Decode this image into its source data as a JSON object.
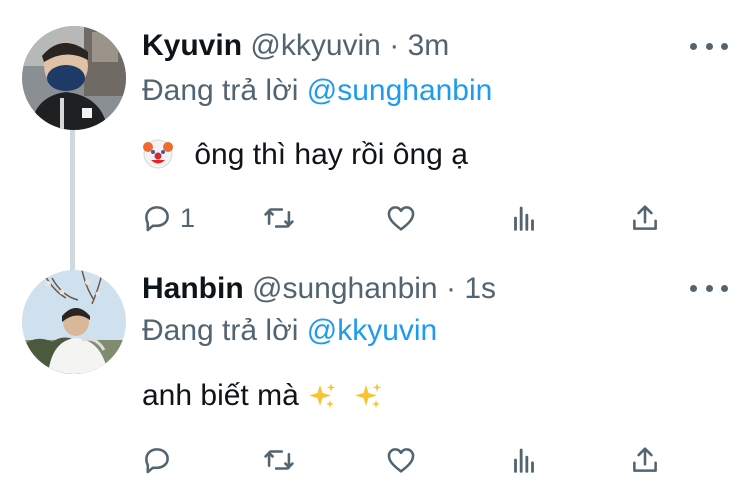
{
  "tweets": [
    {
      "name": "Kyuvin",
      "handle": "@kkyuvin",
      "separator": "·",
      "time": "3m",
      "reply_prefix": "Đang trả lời",
      "reply_to": "@sunghanbin",
      "text": "ông thì hay rồi ông ạ",
      "emoji": "clown-face",
      "reply_count": "1"
    },
    {
      "name": "Hanbin",
      "handle": "@sunghanbin",
      "separator": "·",
      "time": "1s",
      "reply_prefix": "Đang trả lời",
      "reply_to": "@kkyuvin",
      "text": "anh biết mà",
      "emoji": "sparkles",
      "reply_count": ""
    }
  ],
  "icons": [
    "more-icon",
    "reply-icon",
    "retweet-icon",
    "like-icon",
    "stats-icon",
    "share-icon"
  ],
  "colors": {
    "accent": "#1d9bf0",
    "secondary_text": "#536471",
    "thread_line": "#cfd9de"
  }
}
